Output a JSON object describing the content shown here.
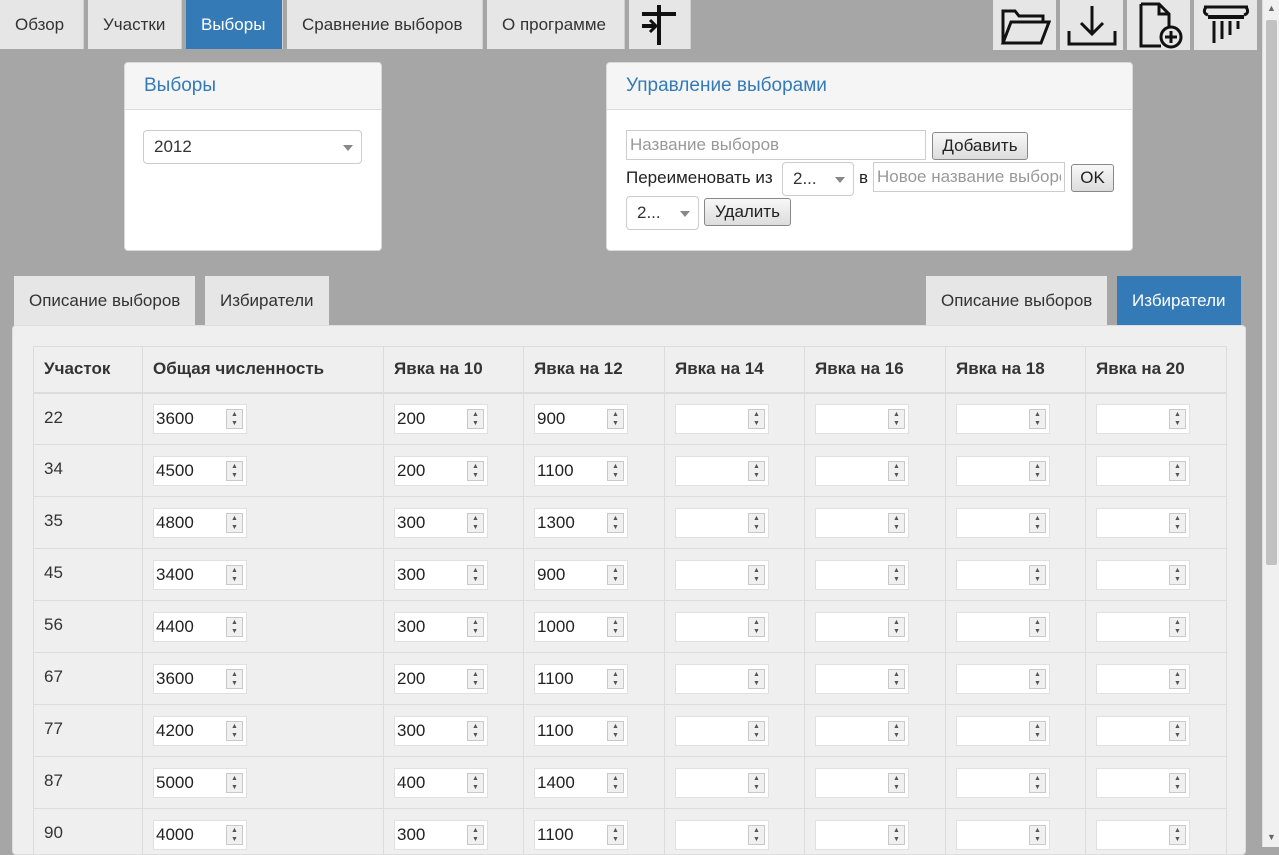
{
  "nav": {
    "tabs": [
      "Обзор",
      "Участки",
      "Выборы",
      "Сравнение выборов",
      "О программе"
    ],
    "active": "Выборы",
    "icons": [
      "signpost-icon",
      "open-folder-icon",
      "download-icon",
      "new-file-icon",
      "pillar-icon"
    ]
  },
  "elections_panel": {
    "title": "Выборы",
    "selected": "2012"
  },
  "manage_panel": {
    "title": "Управление выборами",
    "name_placeholder": "Название выборов",
    "add_label": "Добавить",
    "rename_label": "Переименовать из",
    "rename_from": "2...",
    "in_label": "в",
    "new_name_placeholder": "Новое название выборов",
    "ok_label": "OK",
    "delete_select": "2...",
    "delete_label": "Удалить"
  },
  "subtabs_left": [
    "Описание выборов",
    "Избиратели"
  ],
  "subtabs_right": [
    "Описание выборов",
    "Избиратели"
  ],
  "subtab_right_active": "Избиратели",
  "table": {
    "headers": [
      "Участок",
      "Общая численность",
      "Явка на 10",
      "Явка на 12",
      "Явка на 14",
      "Явка на 16",
      "Явка на 18",
      "Явка на 20"
    ],
    "rows": [
      {
        "site": "22",
        "total": "3600",
        "t10": "200",
        "t12": "900"
      },
      {
        "site": "34",
        "total": "4500",
        "t10": "200",
        "t12": "1100"
      },
      {
        "site": "35",
        "total": "4800",
        "t10": "300",
        "t12": "1300"
      },
      {
        "site": "45",
        "total": "3400",
        "t10": "300",
        "t12": "900"
      },
      {
        "site": "56",
        "total": "4400",
        "t10": "300",
        "t12": "1000"
      },
      {
        "site": "67",
        "total": "3600",
        "t10": "200",
        "t12": "1100"
      },
      {
        "site": "77",
        "total": "4200",
        "t10": "300",
        "t12": "1100"
      },
      {
        "site": "87",
        "total": "5000",
        "t10": "400",
        "t12": "1400"
      },
      {
        "site": "90",
        "total": "4000",
        "t10": "300",
        "t12": "1100"
      }
    ]
  }
}
